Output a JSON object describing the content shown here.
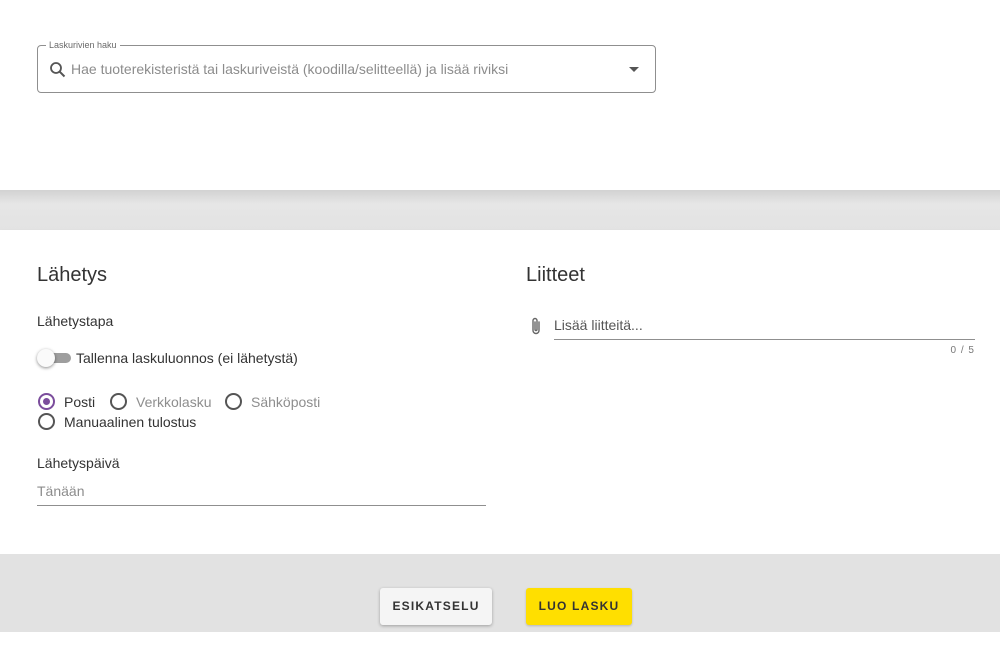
{
  "search": {
    "legend": "Laskurivien haku",
    "placeholder": "Hae tuoterekisteristä tai laskuriveistä (koodilla/selitteellä) ja lisää riviksi"
  },
  "sending": {
    "title": "Lähetys",
    "method_label": "Lähetystapa",
    "draft_toggle_label": "Tallenna laskuluonnos (ei lähetystä)",
    "draft_toggle_on": false,
    "methods": [
      {
        "label": "Posti",
        "checked": true,
        "enabled": true
      },
      {
        "label": "Verkkolasku",
        "checked": false,
        "enabled": false
      },
      {
        "label": "Sähköposti",
        "checked": false,
        "enabled": false
      },
      {
        "label": "Manuaalinen tulostus",
        "checked": false,
        "enabled": true
      }
    ],
    "date_label": "Lähetyspäivä",
    "date_value": "Tänään"
  },
  "attachments": {
    "title": "Liitteet",
    "placeholder": "Lisää liitteitä...",
    "count": "0 / 5"
  },
  "actions": {
    "preview_label": "ESIKATSELU",
    "create_label": "LUO LASKU"
  },
  "colors": {
    "accent_radio": "#7b4d9c",
    "primary_button": "#ffdf00",
    "band_gray": "#e2e2e2"
  },
  "icons": {
    "search": "search-icon",
    "dropdown": "caret-down-icon",
    "attachment": "paperclip-icon"
  }
}
